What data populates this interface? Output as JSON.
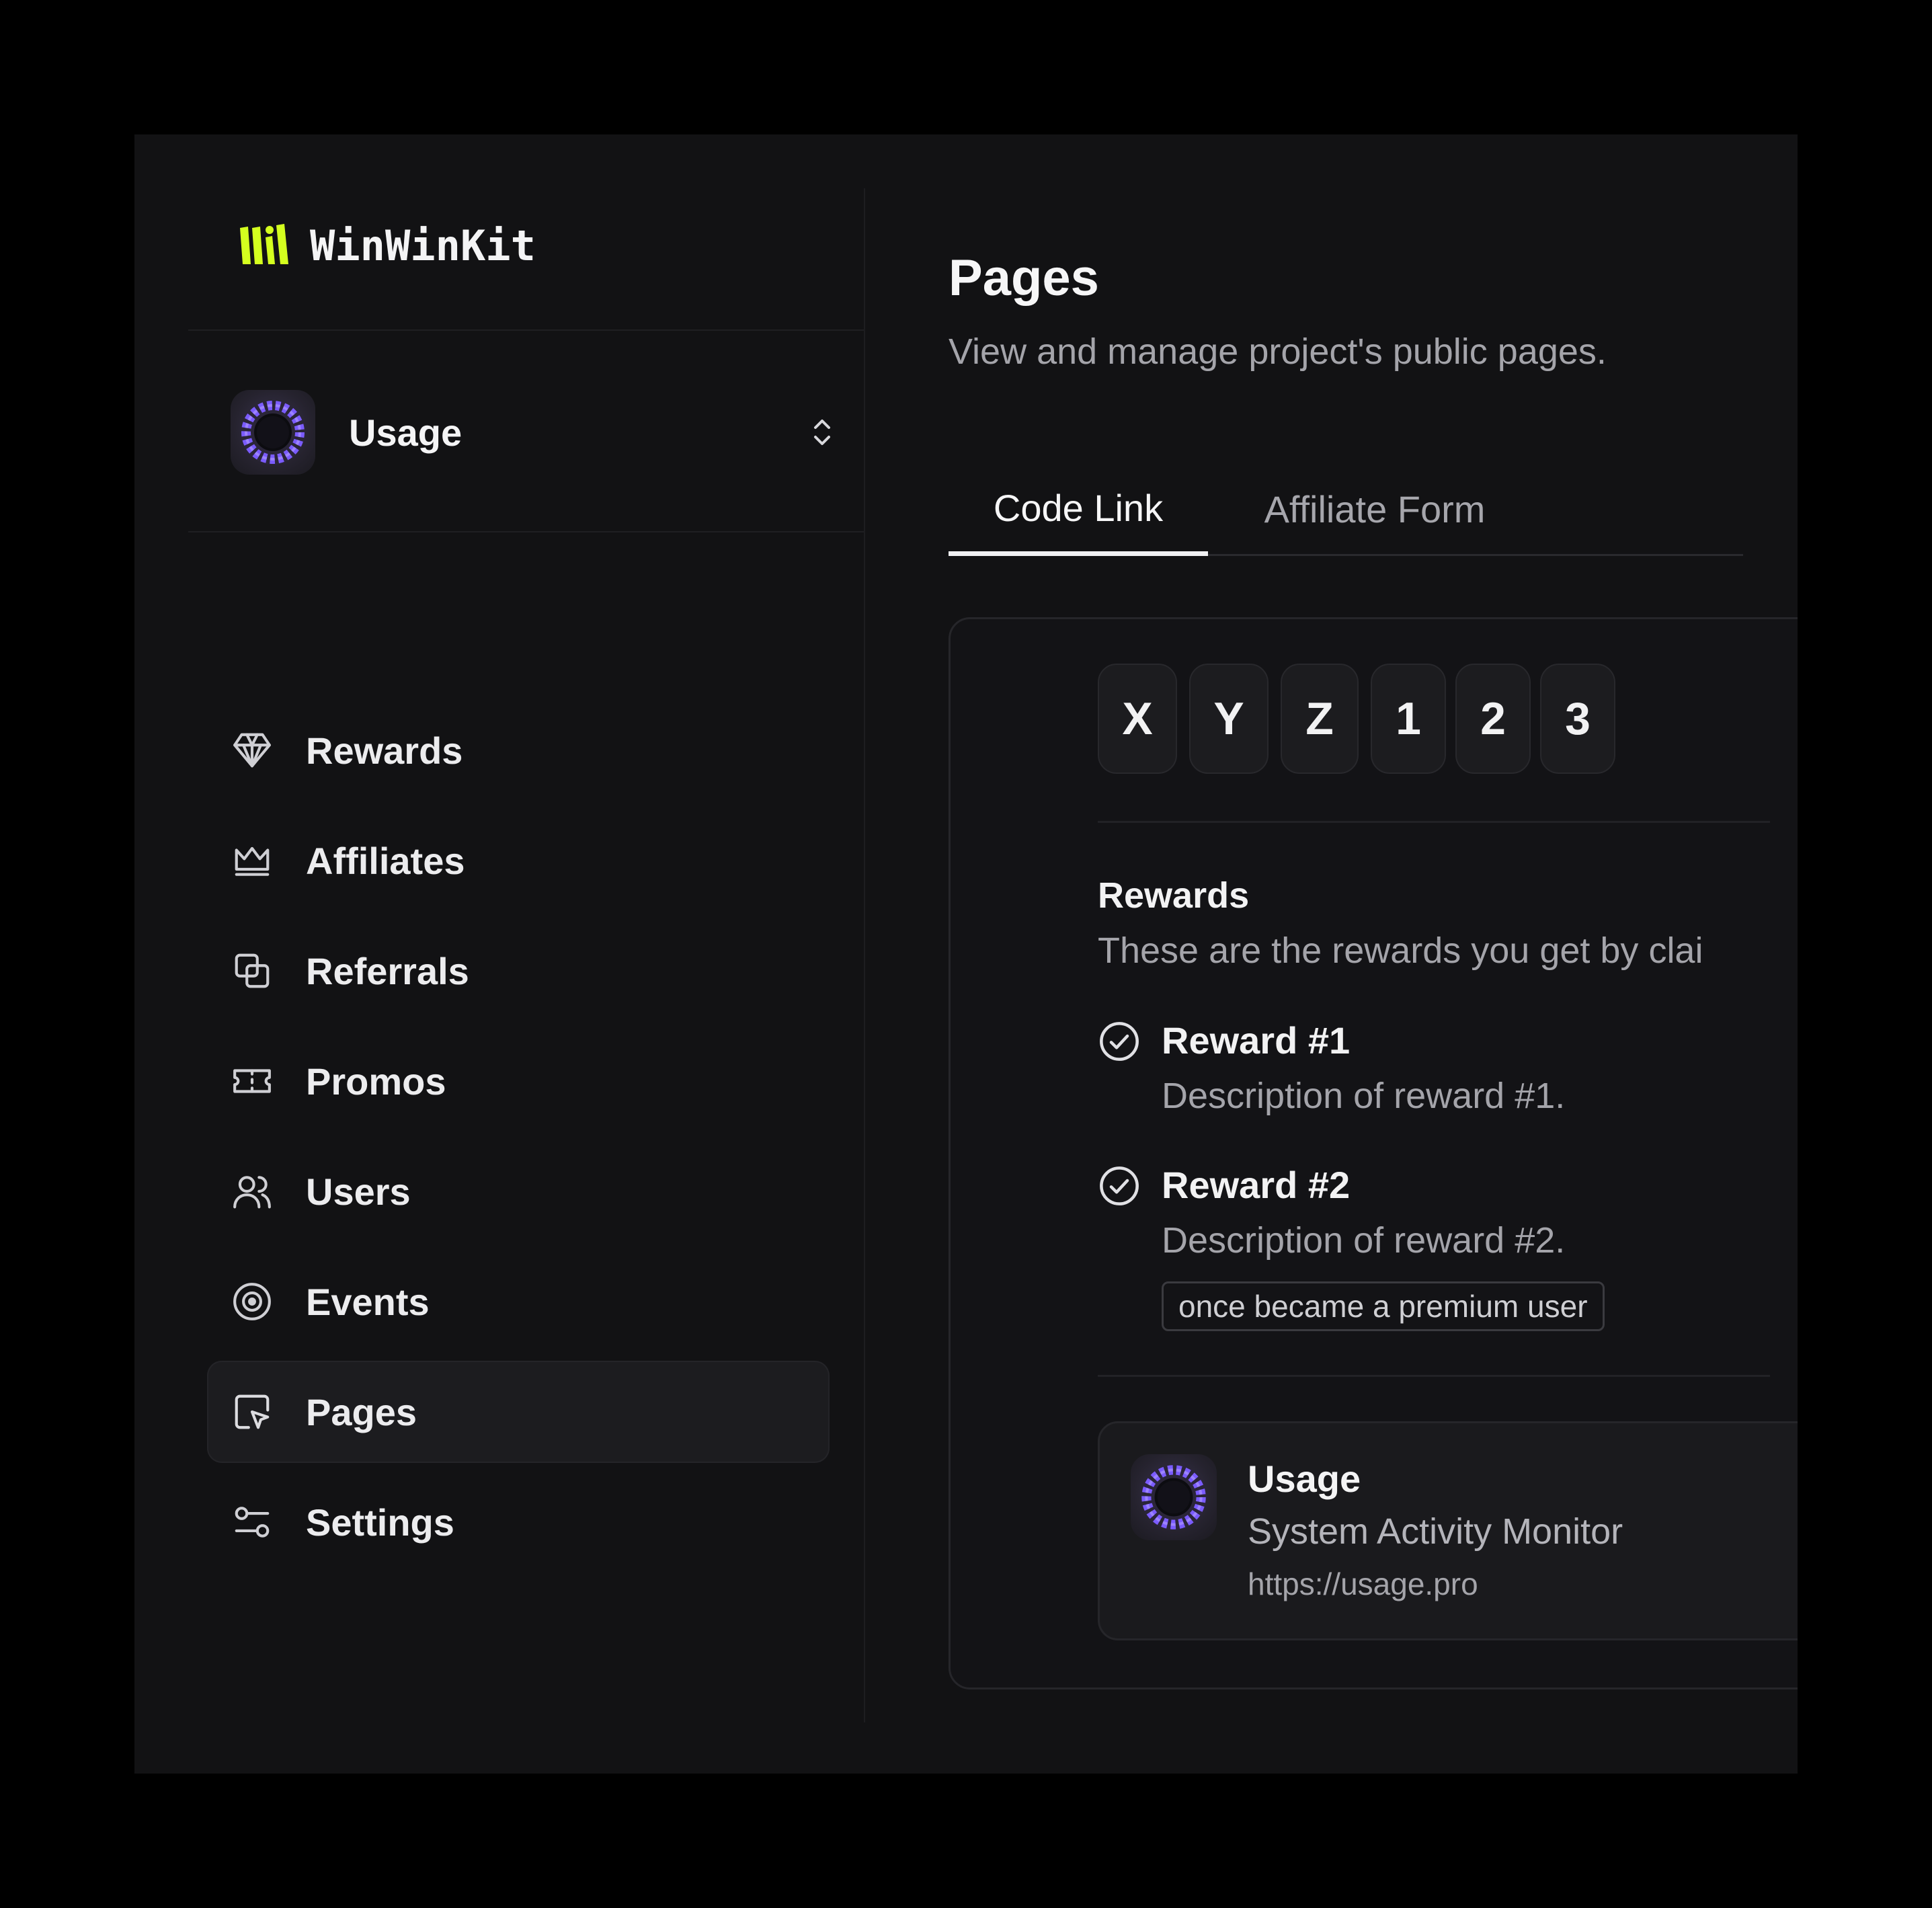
{
  "brand": {
    "name": "WinWinKit",
    "accent_color": "#d4ff1f"
  },
  "project_switcher": {
    "name": "Usage",
    "icon": "usage-app-icon",
    "chevron_icon": "chevron-up-down-icon"
  },
  "sidebar": {
    "items": [
      {
        "label": "Rewards",
        "icon": "diamond-icon",
        "active": false
      },
      {
        "label": "Affiliates",
        "icon": "crown-icon",
        "active": false
      },
      {
        "label": "Referrals",
        "icon": "copy-squares-icon",
        "active": false
      },
      {
        "label": "Promos",
        "icon": "ticket-icon",
        "active": false
      },
      {
        "label": "Users",
        "icon": "users-icon",
        "active": false
      },
      {
        "label": "Events",
        "icon": "target-icon",
        "active": false
      },
      {
        "label": "Pages",
        "icon": "page-cursor-icon",
        "active": true
      },
      {
        "label": "Settings",
        "icon": "sliders-icon",
        "active": false
      }
    ]
  },
  "main": {
    "title": "Pages",
    "subtitle": "View and manage project's public pages.",
    "tabs": [
      {
        "label": "Code Link",
        "active": true
      },
      {
        "label": "Affiliate Form",
        "active": false
      }
    ]
  },
  "preview": {
    "code_chars": [
      "X",
      "Y",
      "Z",
      "1",
      "2",
      "3"
    ],
    "rewards_title": "Rewards",
    "rewards_description": "These are the rewards you get by clai",
    "rewards": [
      {
        "name": "Reward #1",
        "description": "Description of reward #1.",
        "condition": "",
        "icon": "check-circle-icon"
      },
      {
        "name": "Reward #2",
        "description": "Description of reward #2.",
        "condition": "once became a premium user",
        "icon": "check-circle-icon"
      }
    ],
    "app": {
      "name": "Usage",
      "tagline": "System Activity Monitor",
      "url": "https://usage.pro",
      "icon": "usage-app-icon"
    }
  }
}
